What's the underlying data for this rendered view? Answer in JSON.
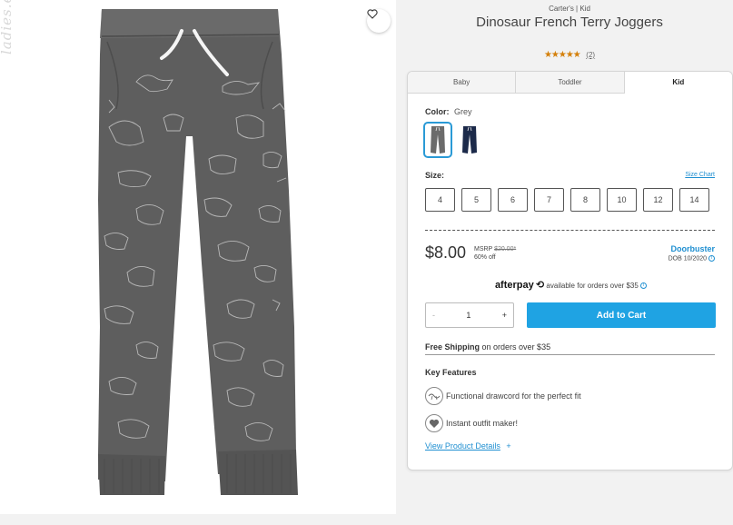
{
  "watermark": "ladies.ep.ua",
  "product": {
    "brand": "Carter's | Kid",
    "title": "Dinosaur French Terry Joggers",
    "stars": "★★★★★",
    "reviews": "(2)"
  },
  "tabs": [
    {
      "label": "Baby",
      "active": false
    },
    {
      "label": "Toddler",
      "active": false
    },
    {
      "label": "Kid",
      "active": true
    }
  ],
  "color": {
    "label": "Color:",
    "value": "Grey",
    "swatches": [
      {
        "name": "Grey",
        "hex": "#6b6b6b",
        "selected": true
      },
      {
        "name": "Navy",
        "hex": "#1c2a4a",
        "selected": false
      }
    ]
  },
  "size": {
    "label": "Size:",
    "chart_link": "Size Chart",
    "options": [
      "4",
      "5",
      "6",
      "7",
      "8",
      "10",
      "12",
      "14"
    ]
  },
  "pricing": {
    "price": "$8.00",
    "msrp_label": "MSRP",
    "msrp_value": "$20.00*",
    "discount": "60% off",
    "promo": "Doorbuster",
    "promo_note": "DOB 10/2020",
    "info_glyph": "i"
  },
  "afterpay": {
    "logo": "afterpay",
    "logo_glyph": "⟲",
    "text": "available for orders over $35",
    "info_glyph": "i"
  },
  "cart": {
    "minus": "-",
    "quantity": "1",
    "plus": "+",
    "add_label": "Add to Cart"
  },
  "shipping": {
    "bold": "Free Shipping",
    "rest": "on orders over $35"
  },
  "features": {
    "heading": "Key Features",
    "items": [
      {
        "icon": "drawcord-icon",
        "text": "Functional drawcord for the perfect fit"
      },
      {
        "icon": "outfit-icon",
        "text": "Instant outfit maker!"
      }
    ],
    "details_link": "View Product Details",
    "details_plus": "+"
  },
  "colors": {
    "accent": "#1fa3e3",
    "link": "#1f8fd1",
    "star": "#d4800b",
    "pants": "#5e5e5e"
  }
}
